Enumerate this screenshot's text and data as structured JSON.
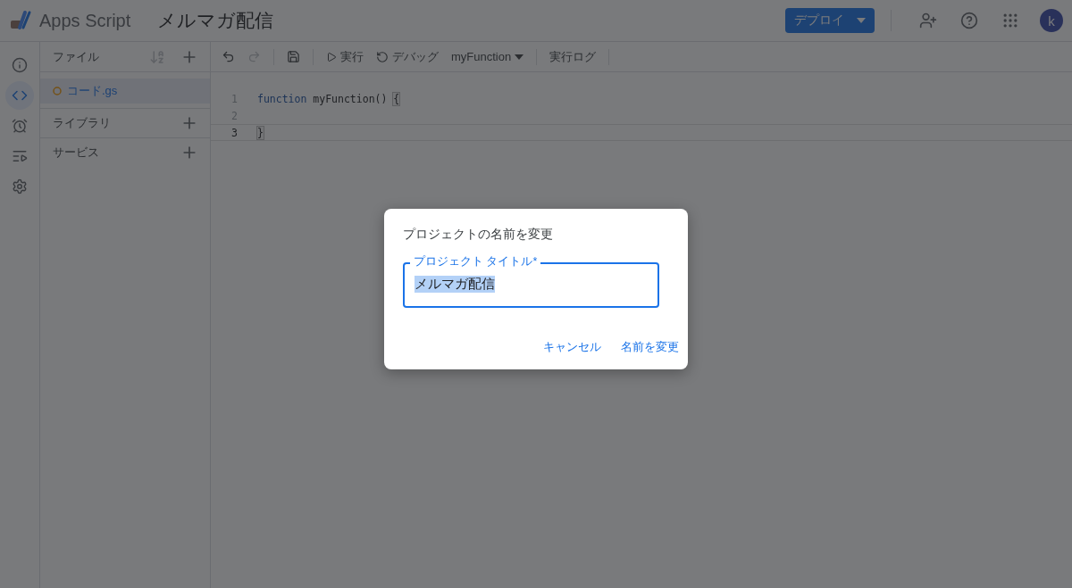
{
  "header": {
    "app_name": "Apps Script",
    "project_title": "メルマガ配信",
    "deploy_button": "デプロイ",
    "avatar_initial": "k"
  },
  "rail": [
    {
      "kind": "overview",
      "selected": false
    },
    {
      "kind": "editor",
      "selected": true
    },
    {
      "kind": "triggers",
      "selected": false
    },
    {
      "kind": "executions",
      "selected": false
    },
    {
      "kind": "settings",
      "selected": false
    }
  ],
  "files_panel": {
    "title": "ファイル",
    "files": [
      {
        "name": "コード.gs",
        "selected": true
      }
    ],
    "sections": [
      "ライブラリ",
      "サービス"
    ]
  },
  "toolbar": {
    "run": "実行",
    "debug": "デバッグ",
    "function": "myFunction",
    "log": "実行ログ"
  },
  "editor": {
    "lines": [
      {
        "number": "1",
        "current": false,
        "tokens": [
          {
            "text": "function",
            "kind": "keyword"
          },
          {
            "text": " myFunction() ",
            "kind": "plain"
          },
          {
            "text": "{",
            "kind": "bracket"
          }
        ]
      },
      {
        "number": "2",
        "current": false
      },
      {
        "number": "3",
        "current": true,
        "tokens": [
          {
            "text": "}",
            "kind": "bracket"
          }
        ]
      }
    ]
  },
  "dialog": {
    "title": "プロジェクトの名前を変更",
    "field_label": "プロジェクト タイトル*",
    "field_value": "メルマガ配信",
    "buttons": [
      "キャンセル",
      "名前を変更"
    ]
  }
}
